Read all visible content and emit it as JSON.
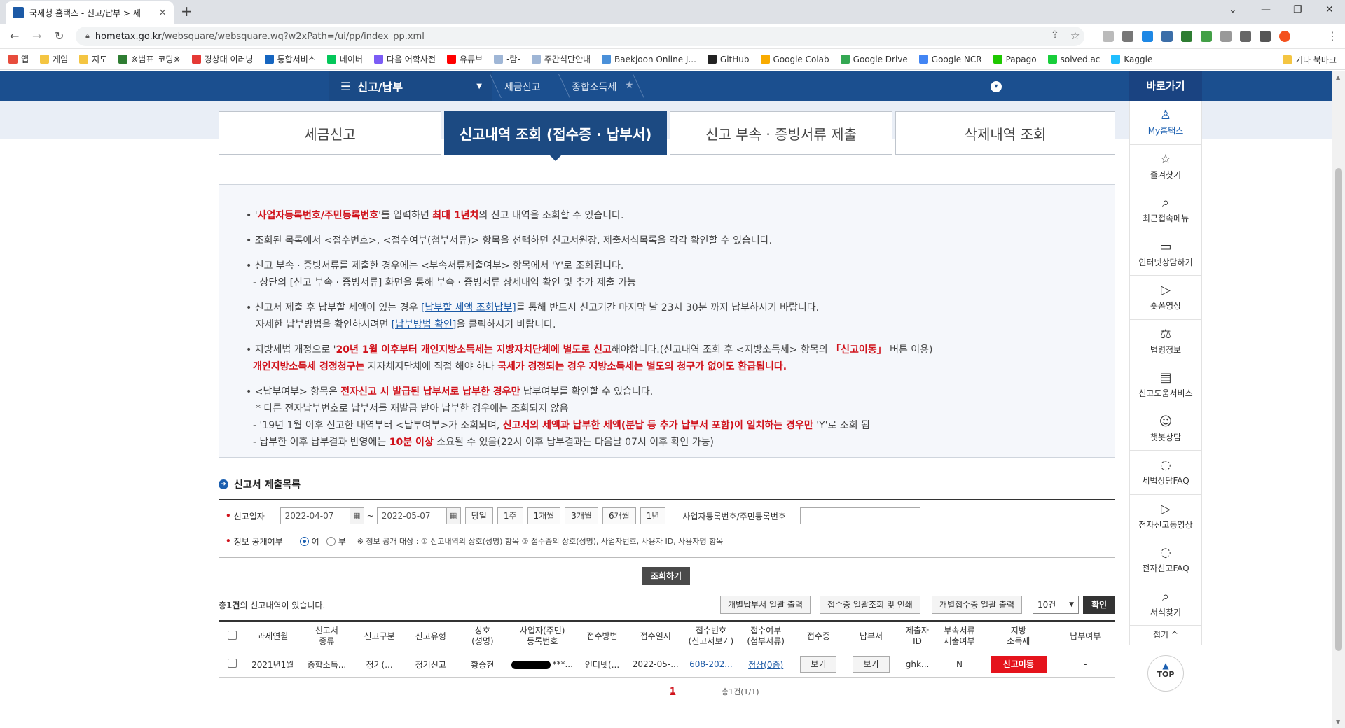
{
  "browser": {
    "tab_title": "국세청 홈택스 - 신고/납부 > 세",
    "tab_close": "×",
    "new_tab": "+",
    "url_domain": "hometax.go.kr",
    "url_path": "/websquare/websquare.wq?w2xPath=/ui/pp/index_pp.xml",
    "bookmarks": [
      {
        "label": "앱",
        "color": "#e74c3c"
      },
      {
        "label": "게임",
        "color": "#f4c542"
      },
      {
        "label": "지도",
        "color": "#f4c542"
      },
      {
        "label": "※범표_코딩※",
        "color": "#2e7d32"
      },
      {
        "label": "경상대 이러닝",
        "color": "#e53935"
      },
      {
        "label": "통합서비스",
        "color": "#1565c0"
      },
      {
        "label": "네이버",
        "color": "#03c75a"
      },
      {
        "label": "다음 어학사전",
        "color": "#7b5cf5"
      },
      {
        "label": "유튜브",
        "color": "#ff0000"
      },
      {
        "label": "-람-",
        "color": "#9fb6d6"
      },
      {
        "label": "주간식단안내",
        "color": "#9fb6d6"
      },
      {
        "label": "Baekjoon Online J...",
        "color": "#4a90d9"
      },
      {
        "label": "GitHub",
        "color": "#222222"
      },
      {
        "label": "Google Colab",
        "color": "#f9ab00"
      },
      {
        "label": "Google Drive",
        "color": "#34a853"
      },
      {
        "label": "Google NCR",
        "color": "#4285f4"
      },
      {
        "label": "Papago",
        "color": "#1ec800"
      },
      {
        "label": "solved.ac",
        "color": "#17ce3a"
      },
      {
        "label": "Kaggle",
        "color": "#20beff"
      }
    ],
    "bookmark_other": "기타 북마크"
  },
  "header": {
    "menu": "신고/납부",
    "crumb1": "세금신고",
    "crumb2": "종합소득세",
    "quick_title": "바로가기"
  },
  "quick_menu": [
    {
      "label": "My홈택스",
      "icon": "user-icon",
      "glyph": "♙"
    },
    {
      "label": "즐겨찾기",
      "icon": "star-icon",
      "glyph": "☆"
    },
    {
      "label": "최근접속메뉴",
      "icon": "search-doc-icon",
      "glyph": "⌕"
    },
    {
      "label": "인터넷상담하기",
      "icon": "laptop-icon",
      "glyph": "▭"
    },
    {
      "label": "숏폼영상",
      "icon": "video-icon",
      "glyph": "▷"
    },
    {
      "label": "법령정보",
      "icon": "gavel-icon",
      "glyph": "⚖"
    },
    {
      "label": "신고도움서비스",
      "icon": "book-icon",
      "glyph": "▤"
    },
    {
      "label": "챗봇상담",
      "icon": "chatbot-icon",
      "glyph": "☺"
    },
    {
      "label": "세법상담FAQ",
      "icon": "chat-icon",
      "glyph": "◌"
    },
    {
      "label": "전자신고동영상",
      "icon": "video-icon",
      "glyph": "▷"
    },
    {
      "label": "전자신고FAQ",
      "icon": "chat-icon",
      "glyph": "◌"
    },
    {
      "label": "서식찾기",
      "icon": "search-icon",
      "glyph": "⌕"
    }
  ],
  "quick_fold": "접기 ^",
  "top_button": "TOP",
  "tabs": [
    {
      "label": "세금신고",
      "active": false
    },
    {
      "label": "신고내역 조회 (접수증 · 납부서)",
      "active": true
    },
    {
      "label": "신고 부속 · 증빙서류 제출",
      "active": false
    },
    {
      "label": "삭제내역 조회",
      "active": false
    }
  ],
  "notice": {
    "n1a": "• '",
    "n1b": "사업자등록번호/주민등록번호",
    "n1c": "'를 입력하면 ",
    "n1d": "최대 1년치",
    "n1e": "의 신고 내역을 조회할 수 있습니다.",
    "n2": "• 조회된 목록에서 <접수번호>, <접수여부(첨부서류)> 항목을 선택하면 신고서원장, 제출서식목록을 각각 확인할 수 있습니다.",
    "n3": "• 신고 부속 · 증빙서류를 제출한 경우에는 <부속서류제출여부> 항목에서 'Y'로 조회됩니다.",
    "n4": "- 상단의 [신고 부속 · 증빙서류] 화면을 통해 부속 · 증빙서류 상세내역 확인 및 추가 제출 가능",
    "n5a": "• 신고서 제출 후 납부할 세액이 있는 경우 ",
    "n5b": "[납부할 세액 조회납부]",
    "n5c": "를 통해 반드시 신고기간 마지막 날 23시 30분 까지 납부하시기 바랍니다.",
    "n6a": "자세한 납부방법을 확인하시려면 ",
    "n6b": "[납부방법 확인]",
    "n6c": "을 클릭하시기 바랍니다.",
    "n7a": "• 지방세법 개정으로 '",
    "n7b": "20년 1월 이후부터 개인지방소득세는 지방자치단체에 별도로 신고",
    "n7c": "해야합니다.(신고내역 조회 후 <지방소득세> 항목의 ",
    "n7d": "「신고이동」",
    "n7e": " 버튼 이용)",
    "n8a": "개인지방소득세 경정청구는",
    "n8b": " 지자체지단체에 직접 해야 하나 ",
    "n8c": "국세가 경정되는 경우 지방소득세는 별도의 청구가 없어도 환급됩니다.",
    "n9a": "• <납부여부> 항목은 ",
    "n9b": "전자신고 시 발급된 납부서로 납부한 경우만",
    "n9c": " 납부여부를 확인할 수 있습니다.",
    "n10": "* 다른 전자납부번호로 납부서를 재발급 받아 납부한 경우에는 조회되지 않음",
    "n11a": "- '19년 1월 이후 신고한 내역부터 <납부여부>가 조회되며, ",
    "n11b": "신고서의 세액과 납부한 세액(분납 등 추가 납부서 포함)이 일치하는 경우만",
    "n11c": " 'Y'로 조회 됨",
    "n12a": "- 납부한 이후 납부결과 반영에는 ",
    "n12b": "10분 이상",
    "n12c": " 소요될 수 있음(22시 이후 납부결과는 다음날 07시 이후 확인 가능)"
  },
  "section_title": "신고서 제출목록",
  "search": {
    "date_label": "신고일자",
    "date_from": "2022-04-07",
    "date_to": "2022-05-07",
    "tilde": "~",
    "periods": [
      "당일",
      "1주",
      "1개월",
      "3개월",
      "6개월",
      "1년"
    ],
    "id_label": "사업자등록번호/주민등록번호",
    "id_value": "",
    "public_label": "정보 공개여부",
    "yes": "여",
    "no": "부",
    "public_note": "※ 정보 공개 대상 : ① 신고내역의 상호(성명) 항목 ② 접수증의 상호(성명), 사업자번호, 사용자 ID, 사용자명 항목",
    "query_button": "조회하기"
  },
  "result": {
    "count_a": "총",
    "count_b": "1건",
    "count_c": "의 신고내역이 있습니다.",
    "btn_bulk_tax_bill": "개별납부서 일괄 출력",
    "btn_bulk_receipt": "접수증 일괄조회 및 인쇄",
    "btn_bulk_individual": "개별접수증 일괄 출력",
    "page_size": "10건",
    "ok": "확인"
  },
  "table": {
    "headers": [
      "",
      "과세연월",
      "신고서\n종류",
      "신고구분",
      "신고유형",
      "상호\n(성명)",
      "사업자(주민)\n등록번호",
      "접수방법",
      "접수일시",
      "접수번호\n(신고서보기)",
      "접수여부\n(첨부서류)",
      "접수증",
      "납부서",
      "제출자\nID",
      "부속서류\n제출여부",
      "지방\n소득세",
      "납부여부"
    ],
    "row": {
      "period": "2021년1월",
      "type": "종합소득...",
      "division": "정기(...",
      "filing": "정기신고",
      "name": "황승현",
      "regno_tail": "***...",
      "method": "인터넷(...",
      "date": "2022-05-...",
      "receipt_no": "608-202...",
      "status": "정상(0종)",
      "receipt_btn": "보기",
      "bill_btn": "보기",
      "submitter": "ghk...",
      "attach": "N",
      "local_tax_btn": "신고이동",
      "paid": "-"
    }
  },
  "pager": {
    "current": "1",
    "total": "총1건(1/1)"
  }
}
